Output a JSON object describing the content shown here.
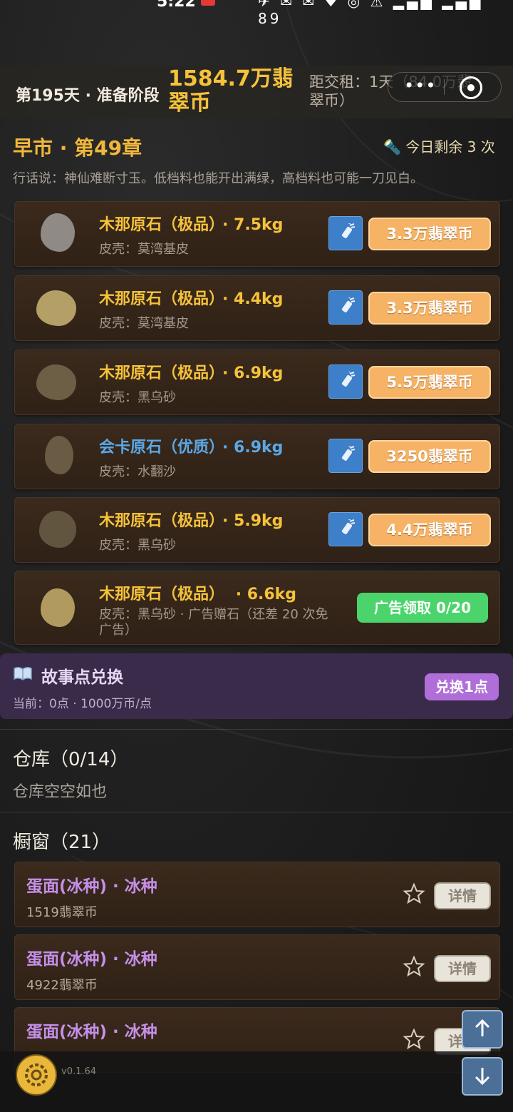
{
  "status_bar": {
    "time": "5:22",
    "icons": "✈ ✉ ✉ ♥ ◎ ⚠ ▂▄▆ ▂▄▆ 89"
  },
  "header": {
    "day_phase": "第195天 · 准备阶段",
    "money": "1584.7万翡翠币",
    "rent": "距交租：1天（84.0万翡翠币）"
  },
  "market": {
    "title": "早市 · 第49章",
    "remaining": "今日剩余 3 次",
    "proverb": "行话说：神仙难断寸玉。低档料也能开出满绿，高档料也可能一刀见白。",
    "stones": [
      {
        "name": "木那原石（极品）",
        "weight": "· 7.5kg",
        "skin": "皮壳：莫湾基皮",
        "price": "3.3万翡翠币",
        "color": "#8f8a86",
        "name_color": "gold"
      },
      {
        "name": "木那原石（极品）",
        "weight": "· 4.4kg",
        "skin": "皮壳：莫湾基皮",
        "price": "3.3万翡翠币",
        "color": "#b4a066",
        "name_color": "gold"
      },
      {
        "name": "木那原石（极品）",
        "weight": "· 6.9kg",
        "skin": "皮壳：黑乌砂",
        "price": "5.5万翡翠币",
        "color": "#6d5e46",
        "name_color": "gold"
      },
      {
        "name": "会卡原石（优质）",
        "weight": "· 6.9kg",
        "skin": "皮壳：水翻沙",
        "price": "3250翡翠币",
        "color": "#6a5b45",
        "name_color": "blue"
      },
      {
        "name": "木那原石（极品）",
        "weight": "· 5.9kg",
        "skin": "皮壳：黑乌砂",
        "price": "4.4万翡翠币",
        "color": "#625540",
        "name_color": "gold"
      }
    ],
    "ad_stone": {
      "name": "木那原石（极品）",
      "weight": "· 6.6kg",
      "skin_line1": "皮壳：黑乌砂 · 广告赠石（还差 20 次免",
      "skin_line2": "广告）",
      "button": "广告领取 0/20",
      "color": "#b09a60"
    }
  },
  "story": {
    "title": "故事点兑换",
    "sub": "当前：0点 · 1000万币/点",
    "button": "兑换1点"
  },
  "warehouse": {
    "title": "仓库（0/14）",
    "empty": "仓库空空如也"
  },
  "showcase": {
    "title": "橱窗（21）",
    "items": [
      {
        "name": "蛋面(冰种) · 冰种",
        "price": "1519翡翠币",
        "detail": "详情"
      },
      {
        "name": "蛋面(冰种) · 冰种",
        "price": "4922翡翠币",
        "detail": "详情"
      },
      {
        "name": "蛋面(冰种) · 冰种",
        "price": "",
        "detail": "详情"
      }
    ]
  },
  "footer": {
    "version": "v0.1.64"
  },
  "colors": {
    "gold": "#f5c23a",
    "blue": "#5aa8e6",
    "price_btn": "#f7b365",
    "ad_btn": "#4cd46c",
    "purple": "#b06ed8"
  }
}
